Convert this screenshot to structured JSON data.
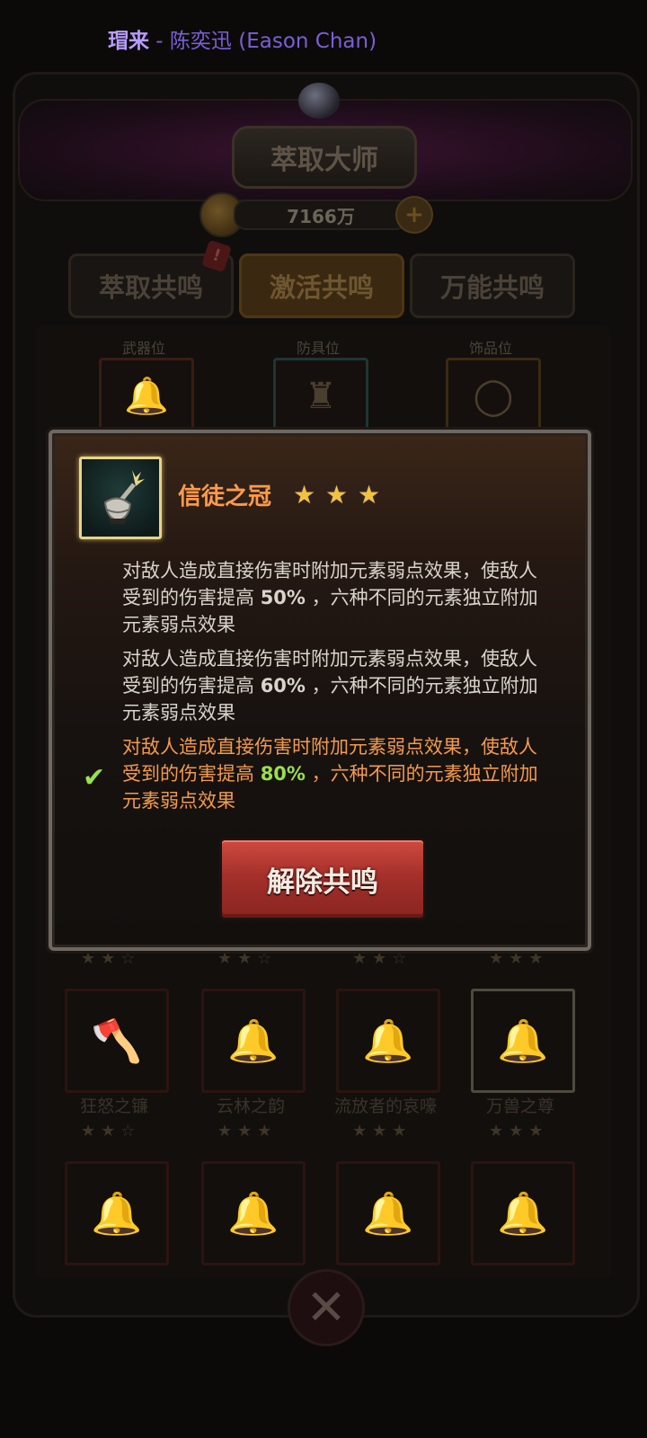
{
  "status_bar": {
    "song_title_fragment": "瑁来",
    "separator": " - ",
    "artist": "陈奕迅 (Eason Chan)"
  },
  "header": {
    "title": "萃取大师",
    "currency_amount": "7166万",
    "add_currency_icon": "plus-icon"
  },
  "tabs": [
    {
      "label": "萃取共鸣",
      "active": false
    },
    {
      "label": "激活共鸣",
      "active": true
    },
    {
      "label": "万能共鸣",
      "active": false
    }
  ],
  "tab_badge": "!",
  "slots": [
    {
      "label": "武器位",
      "icon": "bell-icon"
    },
    {
      "label": "防具位",
      "icon": "crown-icon"
    },
    {
      "label": "饰品位",
      "icon": "ring-icon"
    }
  ],
  "star_rows": [
    "★★☆",
    "★★☆",
    "★★☆",
    "★★★"
  ],
  "grid_row_1": [
    {
      "name": "狂怒之镰",
      "stars": "★★☆",
      "icon": "axe-icon"
    },
    {
      "name": "云林之韵",
      "stars": "★★★",
      "icon": "bell-icon"
    },
    {
      "name": "流放者的哀嚎",
      "stars": "★★★",
      "icon": "bell-icon"
    },
    {
      "name": "万兽之尊",
      "stars": "★★★",
      "icon": "bell-icon"
    }
  ],
  "grid_row_2": [
    {
      "icon": "bell-icon"
    },
    {
      "icon": "bell-icon"
    },
    {
      "icon": "bell-icon"
    },
    {
      "icon": "bell-icon"
    }
  ],
  "modal": {
    "item_name": "信徒之冠",
    "item_stars": 3,
    "item_icon": "crown-icon",
    "effects": [
      {
        "pre": "对敌人造成直接伤害时附加元素弱点效果，使敌人受到的伤害提高 ",
        "pct": "50%",
        "post": " ，六种不同的元素独立附加元素弱点效果",
        "active": false
      },
      {
        "pre": "对敌人造成直接伤害时附加元素弱点效果，使敌人受到的伤害提高 ",
        "pct": "60%",
        "post": " ，六种不同的元素独立附加元素弱点效果",
        "active": false
      },
      {
        "pre": "对敌人造成直接伤害时附加元素弱点效果，使敌人受到的伤害提高 ",
        "pct": "80%",
        "post": " ，六种不同的元素独立附加元素弱点效果",
        "active": true
      }
    ],
    "check_icon": "check-icon",
    "release_button": "解除共鸣"
  },
  "colors": {
    "item_name": "#ff9a4a",
    "active_effect": "#f39a4b",
    "active_percent": "#9adf4a",
    "button": "#b8362f",
    "icon_border": "#e8d489"
  }
}
